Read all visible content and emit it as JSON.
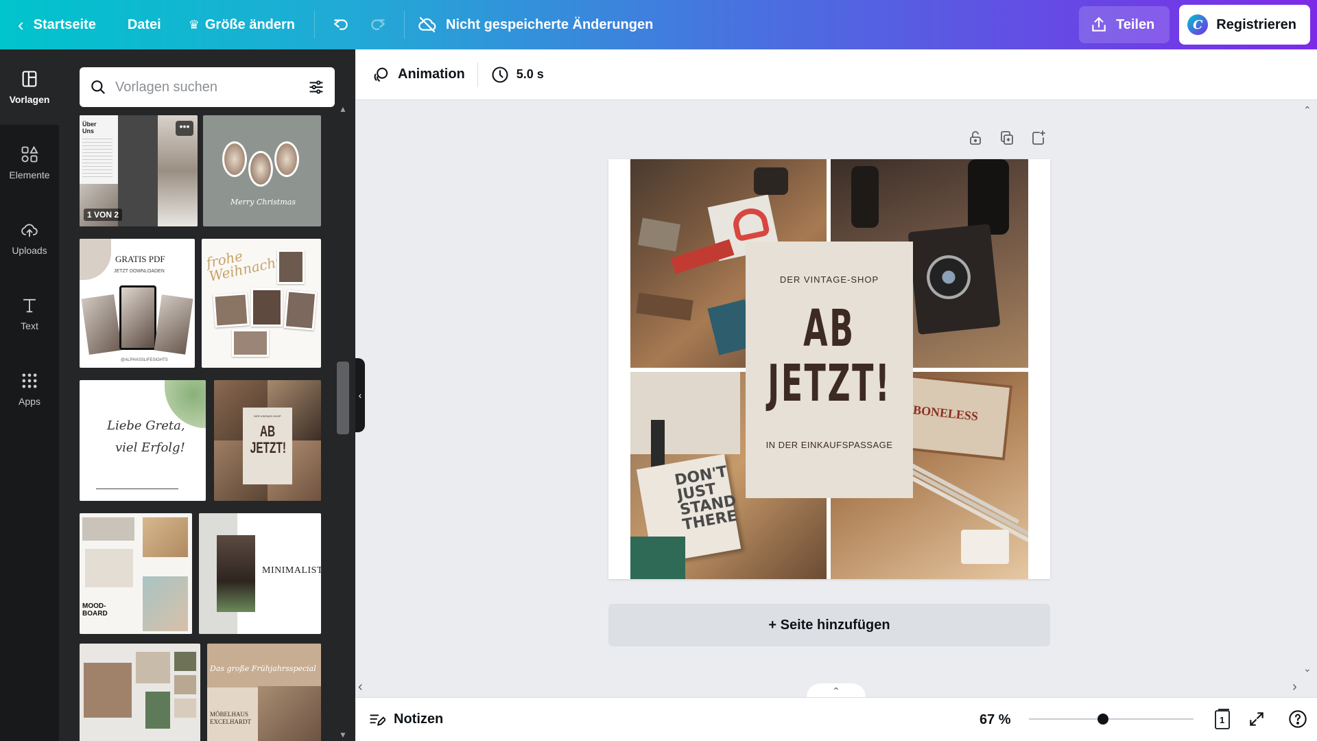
{
  "topbar": {
    "home_label": "Startseite",
    "file_label": "Datei",
    "resize_label": "Größe ändern",
    "save_status": "Nicht gespeicherte Änderungen",
    "share_label": "Teilen",
    "register_label": "Registrieren",
    "logo_letter": "C"
  },
  "rail": {
    "items": [
      {
        "label": "Vorlagen",
        "icon": "layout-icon"
      },
      {
        "label": "Elemente",
        "icon": "shapes-icon"
      },
      {
        "label": "Uploads",
        "icon": "cloud-upload-icon"
      },
      {
        "label": "Text",
        "icon": "text-icon"
      },
      {
        "label": "Apps",
        "icon": "apps-grid-icon"
      }
    ]
  },
  "panel": {
    "search_placeholder": "Vorlagen suchen",
    "templates": {
      "about_page_badge": "1 VON 2",
      "about_title": "Über Uns",
      "xmas_script": "Merry Christmas",
      "gratis_title": "GRATIS PDF",
      "gratis_sub": "JETZT DOWNLOADEN",
      "gratis_handle": "@ALPHASSLIFESIGHTS",
      "weihnachten_script": "frohe Weihnachten",
      "greta_line1": "Liebe Greta,",
      "greta_line2": "viel Erfolg!",
      "abjetzt_small": "DER VINTAGE-SHOP",
      "abjetzt_big1": "AB",
      "abjetzt_big2": "JETZT!",
      "moodboard_label": "MOOD-BOARD",
      "minimalist_label": "MINIMALIST",
      "moebelhaus_script": "Das große Frühjahrsspecial",
      "moebelhaus_name": "MÖBELHAUS EXCELHARDT"
    }
  },
  "editbar": {
    "animation_label": "Animation",
    "duration_label": "5.0 s"
  },
  "design": {
    "top_text": "DER VINTAGE-SHOP",
    "big_line1": "AB",
    "big_line2": "JETZT!",
    "bottom_text": "IN DER EINKAUFSPASSAGE",
    "book_text": "DON'T JUST STAND THERE",
    "sign_text": "BONELESS"
  },
  "canvas": {
    "add_page_label": "+ Seite hinzufügen"
  },
  "footer": {
    "notes_label": "Notizen",
    "zoom_label": "67 %",
    "zoom_level": 0.45,
    "page_count": "1"
  },
  "colors": {
    "gradient_start": "#00c4cc",
    "gradient_end": "#7d2ae8",
    "rail_bg": "#18191b",
    "panel_bg": "#252627",
    "canvas_bg": "#ebecf0",
    "card_bg": "#e6e0d6",
    "card_text": "#3d2a22"
  }
}
